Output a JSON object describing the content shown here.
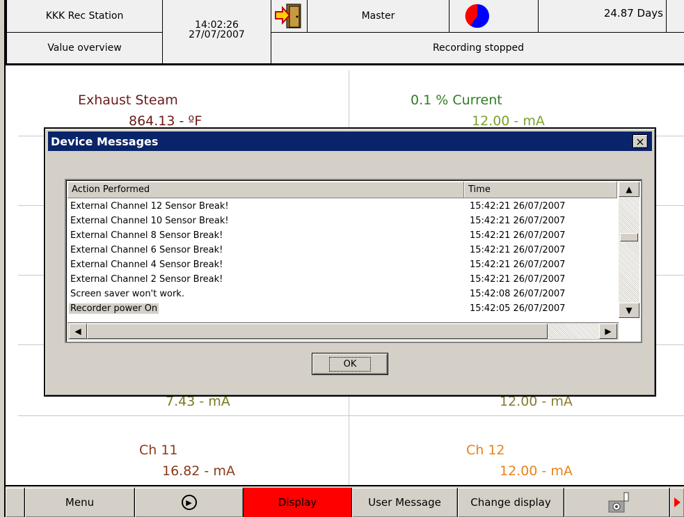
{
  "header": {
    "station": "KKK Rec Station",
    "view": "Value overview",
    "time": "14:02:26",
    "date": "27/07/2007",
    "user": "Master",
    "days": "24.87 Days",
    "status": "Recording stopped",
    "icons": {
      "logout": "exit-door-icon",
      "memory": "pie-indicator-icon"
    }
  },
  "channels": [
    {
      "name": "Exhaust Steam",
      "value": "864.13 - ºF",
      "color": "#6b1a1a"
    },
    {
      "name": "0.1 % Current",
      "value": "12.00 - mA",
      "color": "#2e7d1f"
    },
    {
      "name": "",
      "value": "7.43 - mA",
      "color": "#7a7a1a"
    },
    {
      "name": "",
      "value": "12.00 - mA",
      "color": "#8a7a2a"
    },
    {
      "name": "Ch 11",
      "value": "16.82 - mA",
      "color": "#8b3a1a"
    },
    {
      "name": "Ch 12",
      "value": "12.00 - mA",
      "color": "#e8821a"
    }
  ],
  "dialog": {
    "title": "Device Messages",
    "close": "×",
    "columns": {
      "action": "Action Performed",
      "time": "Time"
    },
    "rows": [
      {
        "action": "External Channel 12 Sensor Break!",
        "time": "15:42:21 26/07/2007"
      },
      {
        "action": "External Channel 10 Sensor Break!",
        "time": "15:42:21 26/07/2007"
      },
      {
        "action": "External Channel 8 Sensor Break!",
        "time": "15:42:21 26/07/2007"
      },
      {
        "action": "External Channel 6 Sensor Break!",
        "time": "15:42:21 26/07/2007"
      },
      {
        "action": "External Channel 4 Sensor Break!",
        "time": "15:42:21 26/07/2007"
      },
      {
        "action": "External Channel 2 Sensor Break!",
        "time": "15:42:21 26/07/2007"
      },
      {
        "action": "Screen saver won't work.",
        "time": "15:42:08 26/07/2007"
      },
      {
        "action": "Recorder power On",
        "time": "15:42:05 26/07/2007"
      }
    ],
    "ok": "OK",
    "scroll_up": "▲",
    "scroll_down": "▼",
    "scroll_left": "◀",
    "scroll_right": "▶"
  },
  "toolbar": {
    "menu": "Menu",
    "play": "▶",
    "display": "Display",
    "user_message": "User Message",
    "change_display": "Change display",
    "colors": {
      "display_bg": "#ff0000",
      "display_fg": "#000000"
    }
  }
}
